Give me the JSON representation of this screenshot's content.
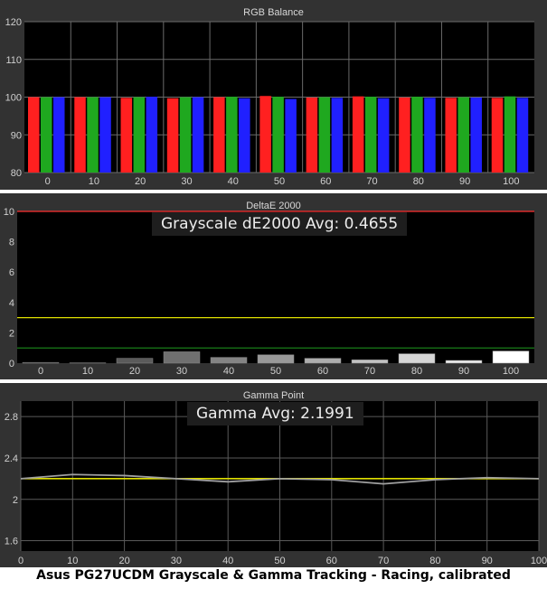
{
  "caption": "Asus PG27UCDM Grayscale & Gamma Tracking - Racing, calibrated",
  "chart_data": [
    {
      "type": "bar",
      "title": "RGB Balance",
      "categories": [
        "0",
        "10",
        "20",
        "30",
        "40",
        "50",
        "60",
        "70",
        "80",
        "90",
        "100"
      ],
      "ylim": [
        80,
        120
      ],
      "yticks": [
        80,
        90,
        100,
        110,
        120
      ],
      "grid": true,
      "series": [
        {
          "color": "#ff2020",
          "values": [
            100.0,
            100.0,
            99.8,
            99.7,
            100.0,
            100.3,
            99.9,
            100.2,
            99.9,
            99.8,
            99.8
          ]
        },
        {
          "color": "#1fa81f",
          "values": [
            100.0,
            100.0,
            100.0,
            100.0,
            100.1,
            100.1,
            100.0,
            100.1,
            100.1,
            100.0,
            100.2
          ]
        },
        {
          "color": "#2020ff",
          "values": [
            100.0,
            100.0,
            100.1,
            100.0,
            99.7,
            99.5,
            99.8,
            99.7,
            99.8,
            99.9,
            99.8
          ]
        }
      ]
    },
    {
      "type": "bar",
      "title": "DeltaE 2000",
      "annotation": "Grayscale dE2000 Avg: 0.4655",
      "categories": [
        "0",
        "10",
        "20",
        "30",
        "40",
        "50",
        "60",
        "70",
        "80",
        "90",
        "100"
      ],
      "values": [
        0.05,
        0.02,
        0.32,
        0.75,
        0.38,
        0.55,
        0.32,
        0.22,
        0.62,
        0.18,
        0.8
      ],
      "ylim": [
        0,
        10
      ],
      "yticks": [
        0,
        2,
        4,
        6,
        8,
        10
      ],
      "thresholds": [
        {
          "value": 10,
          "color": "#ff3030"
        },
        {
          "value": 3,
          "color": "#e0e000"
        },
        {
          "value": 1,
          "color": "#1a8a1a"
        }
      ]
    },
    {
      "type": "line",
      "title": "Gamma Point",
      "annotation": "Gamma Avg: 2.1991",
      "x": [
        0,
        10,
        20,
        30,
        40,
        50,
        60,
        70,
        80,
        90,
        100
      ],
      "xticks": [
        0,
        10,
        20,
        30,
        40,
        50,
        60,
        70,
        80,
        90,
        100
      ],
      "ylim": [
        1.5,
        2.95
      ],
      "yticks": [
        1.6,
        2,
        2.4,
        2.8
      ],
      "target": {
        "value": 2.2,
        "color": "#e0e000"
      },
      "series": [
        {
          "color": "#a0a0a0",
          "values": [
            2.2,
            2.24,
            2.23,
            2.2,
            2.17,
            2.2,
            2.19,
            2.15,
            2.19,
            2.21,
            2.2
          ]
        }
      ]
    }
  ]
}
